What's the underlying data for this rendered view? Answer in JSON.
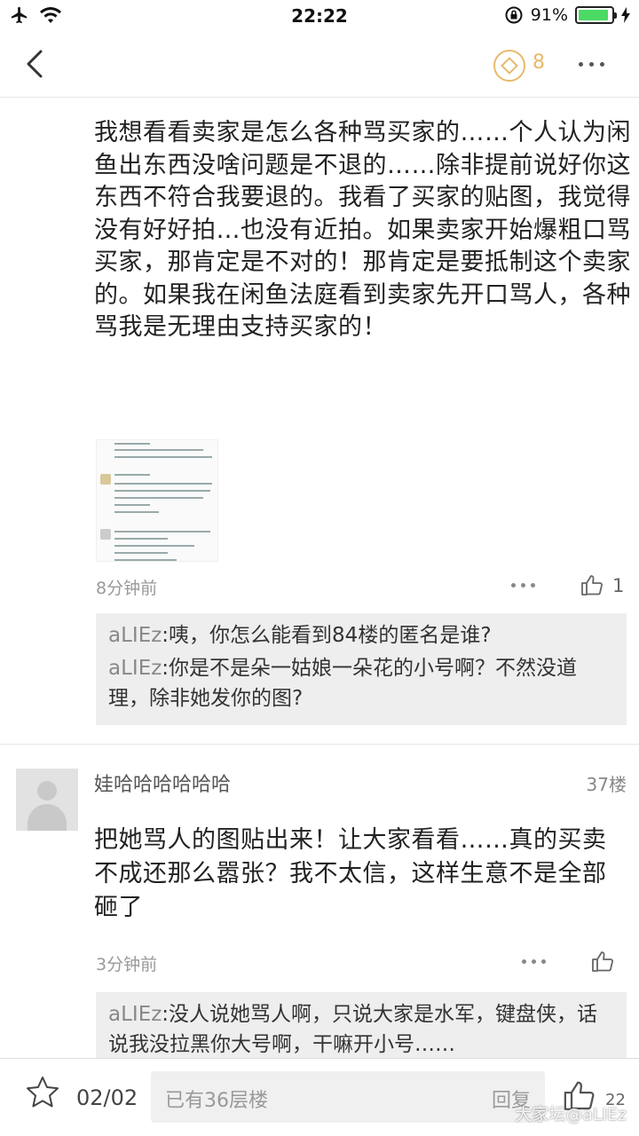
{
  "status": {
    "time": "22:22",
    "battery": "91%",
    "battery_fraction": 0.91
  },
  "nav": {
    "coin_count": "8"
  },
  "post": {
    "text": "我想看看卖家是怎么各种骂买家的……个人认为闲鱼出东西没啥问题是不退的……除非提前说好你这东西不符合我要退的。我看了买家的贴图，我觉得没有好好拍…也没有近拍。如果卖家开始爆粗口骂买家，那肯定是不对的！那肯定是要抵制这个卖家的。如果我在闲鱼法庭看到卖家先开口骂人，各种骂我是无理由支持买家的！",
    "time": "8分钟前",
    "like_count": "1",
    "replies": [
      {
        "user": "aLIEz",
        "sep": ":",
        "text": "咦，你怎么能看到84楼的匿名是谁?"
      },
      {
        "user": "aLIEz",
        "sep": ":",
        "text": "你是不是朵一姑娘一朵花的小号啊？不然没道理，除非她发你的图?"
      }
    ]
  },
  "floor37": {
    "username": "娃哈哈哈哈哈哈",
    "floor": "37楼",
    "text": "把她骂人的图贴出来！让大家看看……真的买卖不成还那么嚣张？我不太信，这样生意不是全部砸了",
    "time": "3分钟前",
    "replies": [
      {
        "user": "aLIEz",
        "sep": ":",
        "text": "没人说她骂人啊，只说大家是水军，键盘侠，话说我没拉黑你大号啊，干嘛开小号……"
      }
    ]
  },
  "bottom": {
    "page": "02/02",
    "placeholder": "已有36层楼",
    "reply_button": "回复",
    "like_count": "22",
    "watermark": "大家坛@aLIEz"
  }
}
